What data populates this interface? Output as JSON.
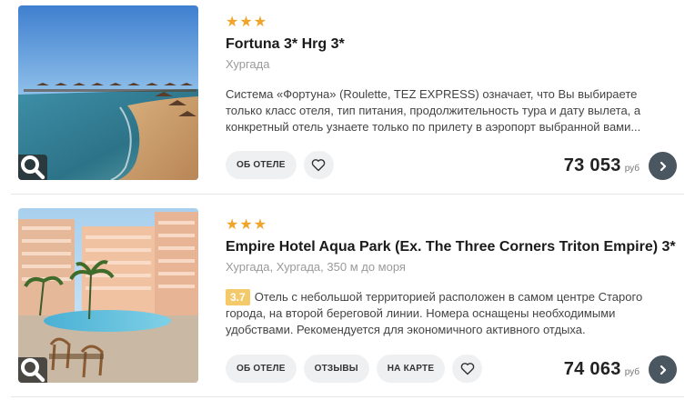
{
  "hotels": [
    {
      "stars": "★★★",
      "name": "Fortuna 3* Hrg 3*",
      "location": "Хургада",
      "description": "Система «Фортуна» (Roulette, TEZ EXPRESS) означает, что Вы выбираете только класс отеля, тип питания, продолжительность тура и дату вылета, а конкретный отель узнаете только по прилету в аэропорт выбранной вами...",
      "buttons": {
        "about": "ОБ ОТЕЛЕ"
      },
      "price": "73 053",
      "currency": "руб"
    },
    {
      "stars": "★★★",
      "name": "Empire Hotel Aqua Park (Ex. The Three Corners Triton Empire) 3*",
      "location": "Хургада, Хургада, 350 м до моря",
      "rating": "3.7",
      "description": "Отель с небольшой территорией расположен в самом центре Старого города, на второй береговой линии. Номера оснащены необходимыми удобствами. Рекомендуется для экономичного активного отдыха.",
      "buttons": {
        "about": "ОБ ОТЕЛЕ",
        "reviews": "ОТЗЫВЫ",
        "map": "НА КАРТЕ"
      },
      "price": "74 063",
      "currency": "руб"
    }
  ],
  "colors": {
    "stars": "#f0a52a",
    "rating_badge": "#f3c96a",
    "go_button": "#4a5660",
    "pill_bg": "#eef0f2"
  },
  "icons": {
    "zoom": "search-icon",
    "favorite": "heart-icon",
    "next": "chevron-right-icon"
  }
}
